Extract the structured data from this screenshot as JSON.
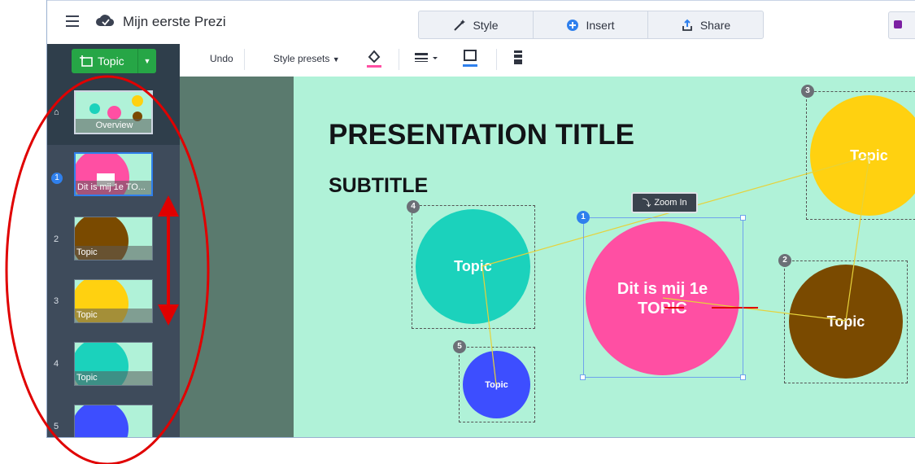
{
  "app": {
    "title": "Mijn eerste Prezi"
  },
  "tabs": [
    {
      "label": "Style",
      "icon": "wand-icon"
    },
    {
      "label": "Insert",
      "icon": "plus-circle-icon"
    },
    {
      "label": "Share",
      "icon": "share-icon"
    }
  ],
  "toolbar": {
    "undo": "Undo",
    "style_presets": "Style presets"
  },
  "add_topic": {
    "label": "Topic"
  },
  "sidebar": {
    "overview_label": "Overview",
    "slides": [
      {
        "num": "1",
        "caption": "Dit is mij 1e TO...",
        "color": "#ff4fa3"
      },
      {
        "num": "2",
        "caption": "Topic",
        "color": "#7a4a00"
      },
      {
        "num": "3",
        "caption": "Topic",
        "color": "#ffd110"
      },
      {
        "num": "4",
        "caption": "Topic",
        "color": "#1bd2bc"
      },
      {
        "num": "5",
        "caption": "",
        "color": "#3d4eff"
      }
    ]
  },
  "canvas": {
    "title": "PRESENTATION TITLE",
    "subtitle": "SUBTITLE",
    "zoom_in": "Zoom In",
    "topics": [
      {
        "num": "1",
        "line1": "Dit is mij 1e",
        "line2": "TOPIC",
        "color": "#ff4fa3"
      },
      {
        "num": "2",
        "label": "Topic",
        "color": "#7a4a00"
      },
      {
        "num": "3",
        "label": "Topic",
        "color": "#ffd110"
      },
      {
        "num": "4",
        "label": "Topic",
        "color": "#1bd2bc"
      },
      {
        "num": "5",
        "label": "Topic",
        "color": "#3d4eff"
      }
    ]
  },
  "colors": {
    "sidebar": "#3e4b5b",
    "canvas": "#b0f2d8",
    "annotation": "#e00000",
    "primary_green": "#26a646"
  }
}
